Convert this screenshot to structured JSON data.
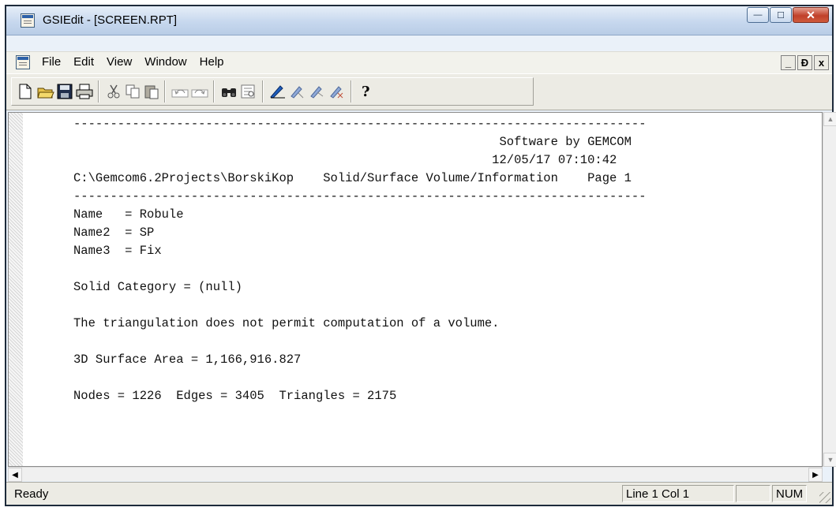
{
  "window": {
    "title": "GSIEdit - [SCREEN.RPT]"
  },
  "controls": {
    "minimize": "—",
    "maximize": "☐",
    "close": "✕"
  },
  "menu": {
    "items": [
      {
        "label": "File"
      },
      {
        "label": "Edit"
      },
      {
        "label": "View"
      },
      {
        "label": "Window"
      },
      {
        "label": "Help"
      }
    ],
    "mdi_buttons": [
      "_",
      "Ɖ",
      "x"
    ]
  },
  "toolbar": {
    "icons": [
      "new-document-icon",
      "open-folder-icon",
      "save-icon",
      "print-icon",
      "cut-icon",
      "copy-icon",
      "paste-icon",
      "undo-icon",
      "redo-icon",
      "find-icon",
      "replace-icon",
      "mark-1-icon",
      "mark-2-icon",
      "mark-3-icon",
      "mark-4-icon",
      "help-icon"
    ]
  },
  "report": {
    "lines": [
      "------------------------------------------------------------------------------",
      "                                                          Software by GEMCOM",
      "                                                         12/05/17 07:10:42",
      "C:\\Gemcom6.2Projects\\BorskiKop    Solid/Surface Volume/Information    Page 1",
      "------------------------------------------------------------------------------",
      "Name   = Robule",
      "Name2  = SP",
      "Name3  = Fix",
      "",
      "Solid Category = (null)",
      "",
      "The triangulation does not permit computation of a volume.",
      "",
      "3D Surface Area = 1,166,916.827",
      "",
      "Nodes = 1226  Edges = 3405  Triangles = 2175"
    ]
  },
  "status": {
    "ready": "Ready",
    "position": "Line 1 Col 1",
    "mode1": "",
    "num": "NUM"
  }
}
